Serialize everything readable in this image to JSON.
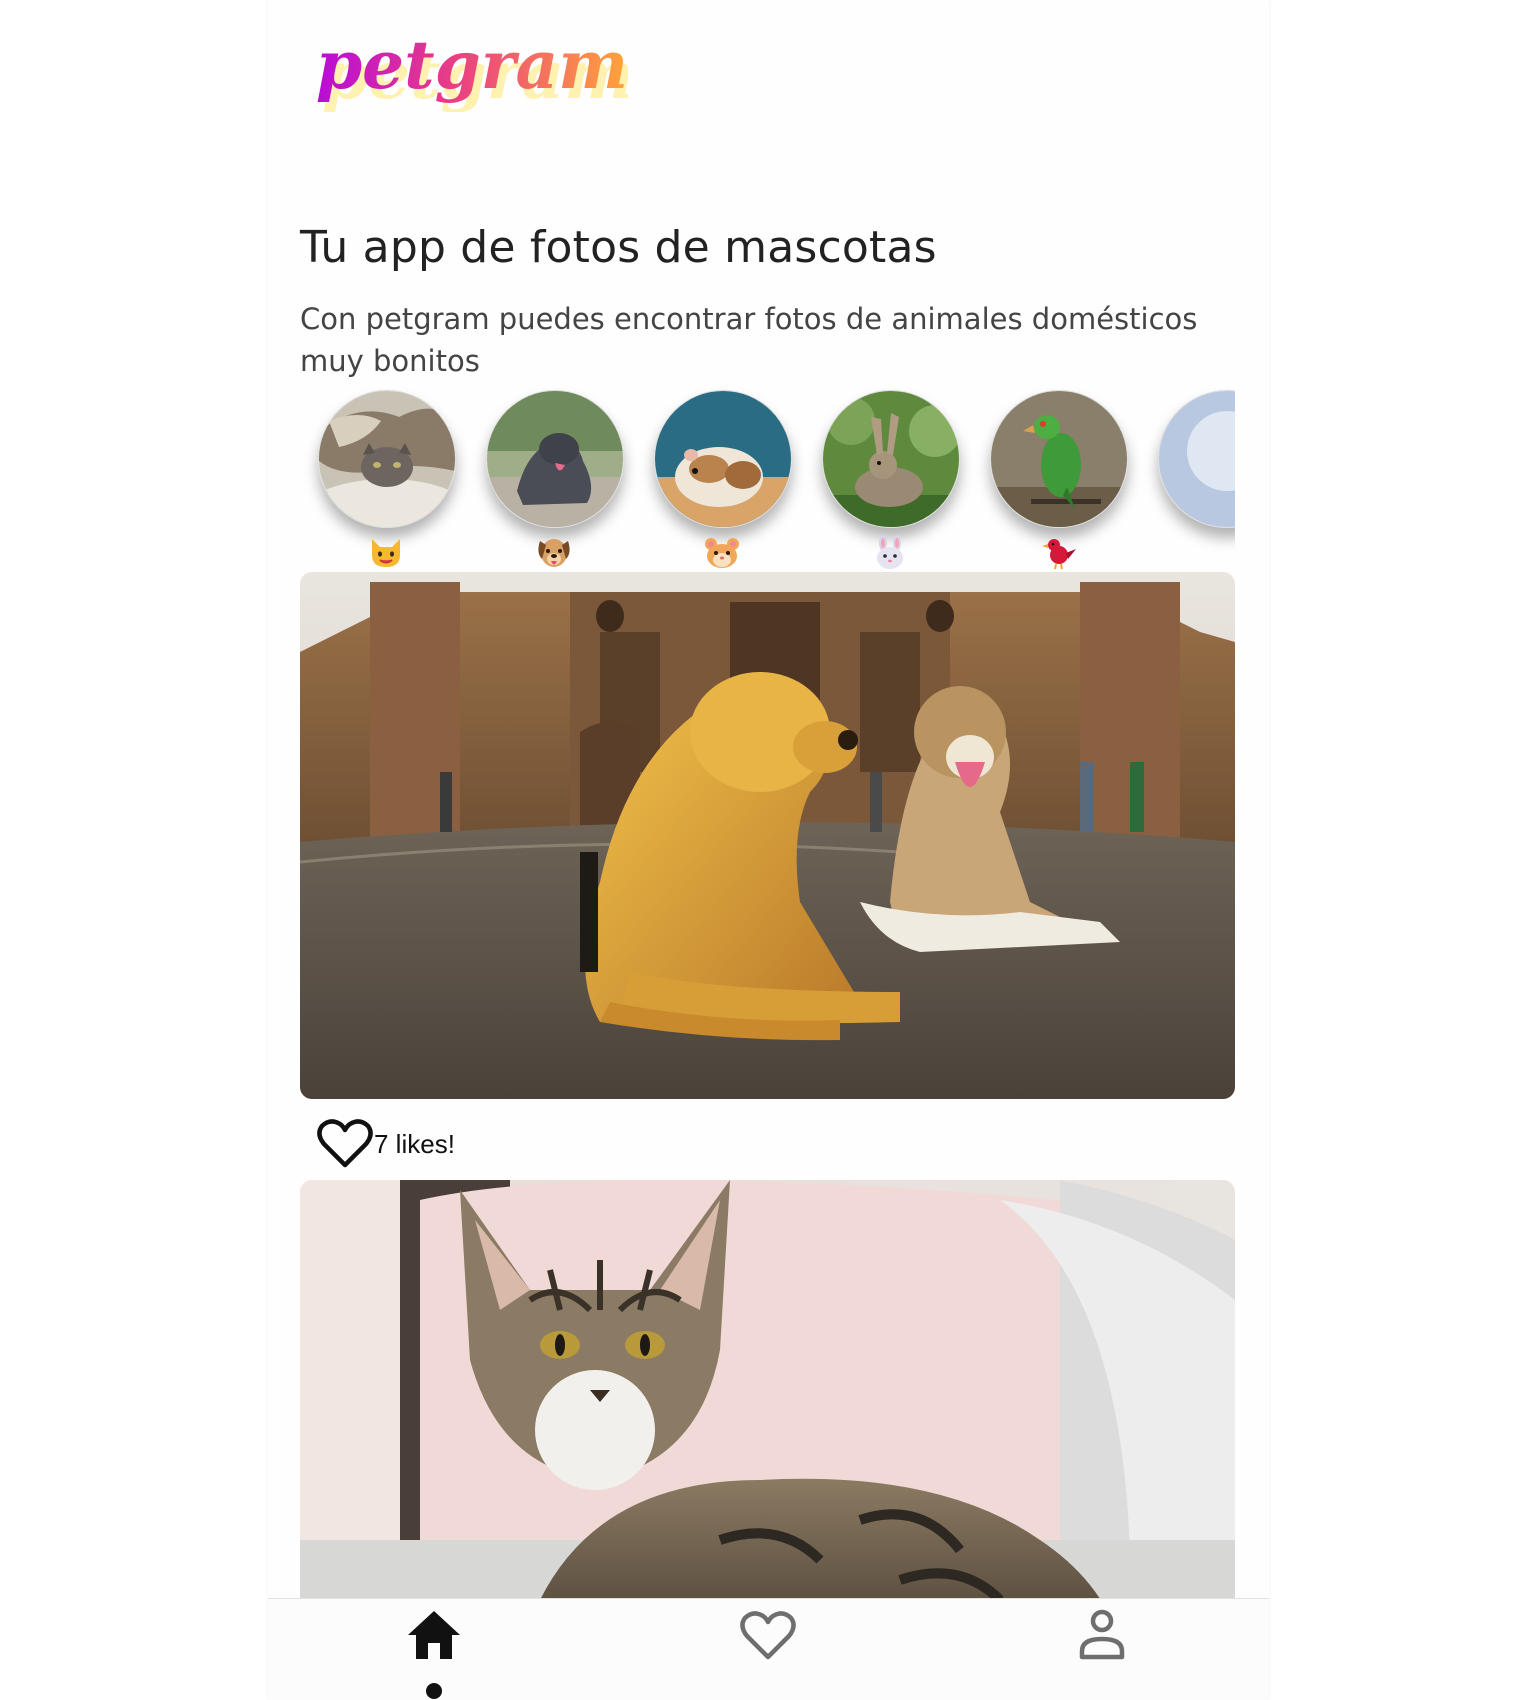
{
  "app": {
    "logo_text": "petgram"
  },
  "hero": {
    "title": "Tu app de fotos de mascotas",
    "description": "Con petgram puedes encontrar fotos de animales domésticos muy bonitos"
  },
  "categories": [
    {
      "name": "cats",
      "emoji": "🐱",
      "icon": "cat-face-icon"
    },
    {
      "name": "dogs",
      "emoji": "🐶",
      "icon": "dog-face-icon"
    },
    {
      "name": "hamsters",
      "emoji": "🐹",
      "icon": "hamster-face-icon"
    },
    {
      "name": "rabbits",
      "emoji": "🐰",
      "icon": "rabbit-face-icon"
    },
    {
      "name": "birds",
      "emoji": "🐦",
      "icon": "bird-icon"
    }
  ],
  "photos": [
    {
      "subject": "two dogs",
      "likes_label": "7 likes!",
      "liked": false
    },
    {
      "subject": "tabby cat"
    }
  ],
  "navbar": {
    "items": [
      {
        "name": "home",
        "icon": "home-icon",
        "active": true
      },
      {
        "name": "favorites",
        "icon": "heart-icon",
        "active": false
      },
      {
        "name": "user",
        "icon": "user-icon",
        "active": false
      }
    ]
  },
  "colors": {
    "logo_gradient_start": "#c50ed4",
    "logo_gradient_end": "#fda33b",
    "logo_shadow": "#fff2b3",
    "text_primary": "#222222",
    "text_secondary": "#444444",
    "icon_active": "#111111",
    "icon_inactive": "#6e6e6e"
  }
}
